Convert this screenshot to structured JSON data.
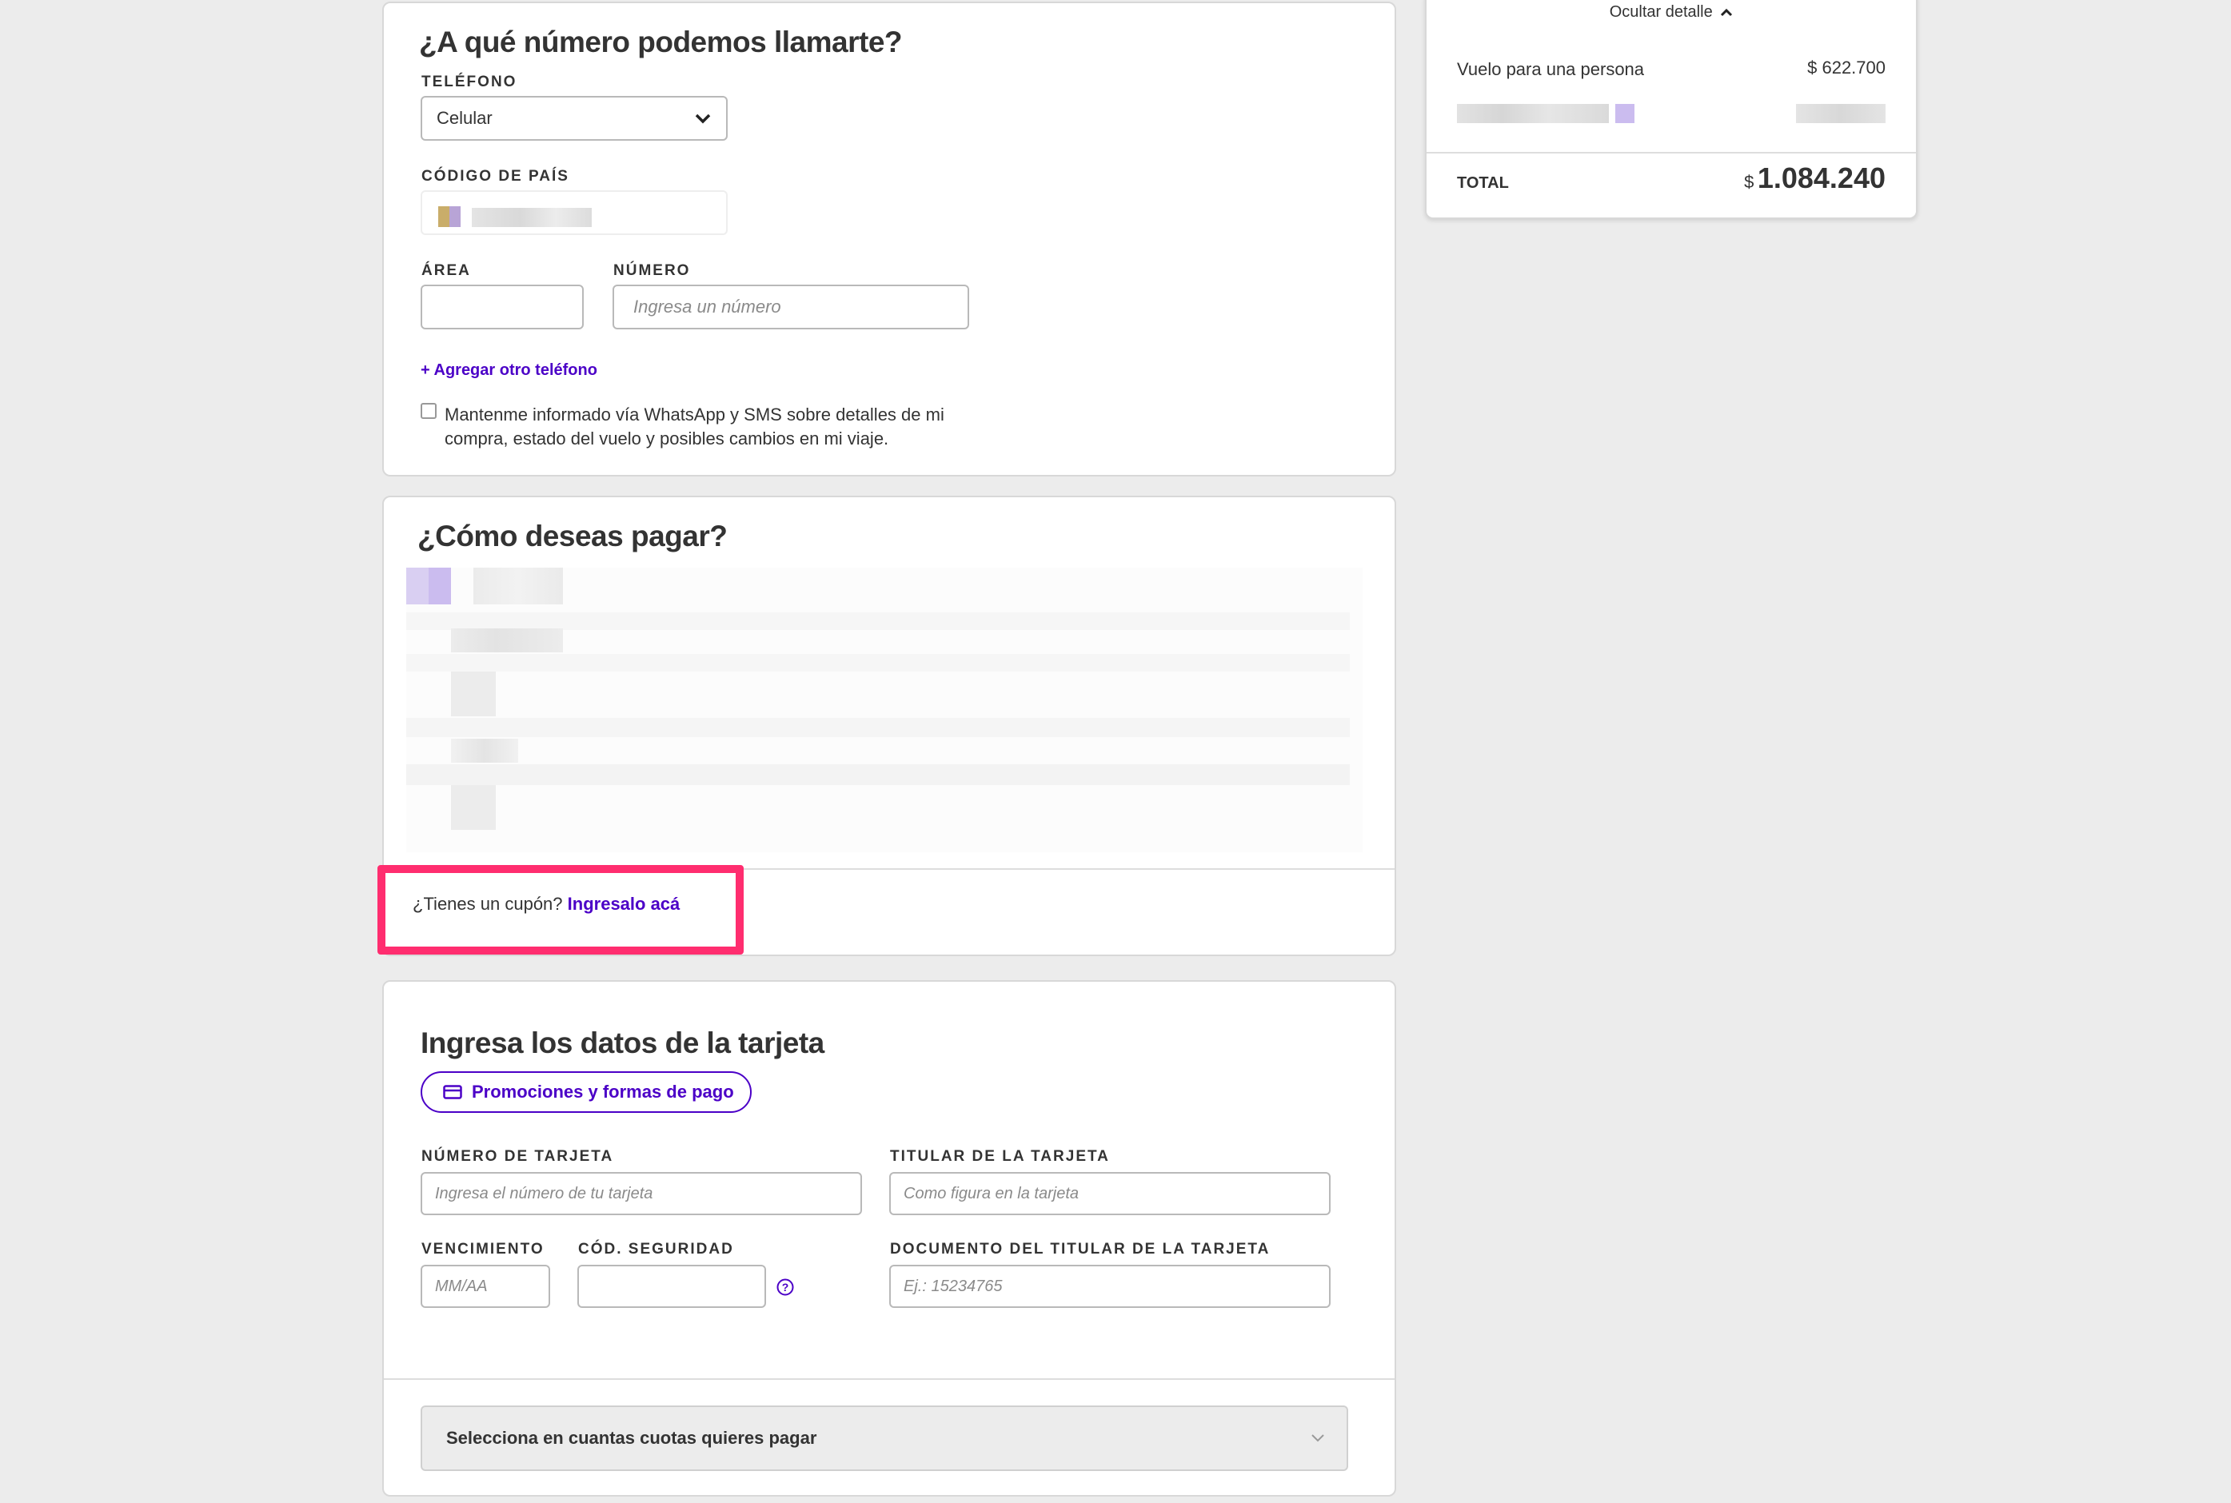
{
  "phone_section": {
    "title": "¿A qué número podemos llamarte?",
    "phone_label": "TELÉFONO",
    "phone_type_value": "Celular",
    "country_code_label": "CÓDIGO DE PAÍS",
    "area_label": "ÁREA",
    "area_value": "",
    "number_label": "NÚMERO",
    "number_placeholder": "Ingresa un número",
    "add_phone_link": "+ Agregar otro teléfono",
    "whatsapp_checkbox_line1": "Mantenme informado vía WhatsApp y SMS sobre detalles de mi",
    "whatsapp_checkbox_line2": "compra, estado del vuelo y posibles cambios en mi viaje.",
    "whatsapp_checked": false
  },
  "payment_section": {
    "title": "¿Cómo deseas pagar?",
    "coupon_text": "¿Tienes un cupón?",
    "coupon_link": "Ingresalo acá"
  },
  "card_section": {
    "title": "Ingresa los datos de la tarjeta",
    "promo_button": "Promociones y formas de pago",
    "card_number_label": "NÚMERO DE TARJETA",
    "card_number_placeholder": "Ingresa el número de tu tarjeta",
    "holder_label": "TITULAR DE LA TARJETA",
    "holder_placeholder": "Como figura en la tarjeta",
    "expiry_label": "VENCIMIENTO",
    "expiry_placeholder": "MM/AA",
    "cvv_label": "CÓD. SEGURIDAD",
    "document_label": "DOCUMENTO DEL TITULAR DE LA TARJETA",
    "document_placeholder": "Ej.: 15234765",
    "installments_select": "Selecciona en cuantas cuotas quieres pagar"
  },
  "summary": {
    "hide_detail": "Ocultar detalle",
    "flight_label": "Vuelo para una persona",
    "flight_price": "$ 622.700",
    "total_label": "TOTAL",
    "total_currency": "$",
    "total_amount": "1.084.240"
  },
  "colors": {
    "accent": "#4b00c7",
    "highlight": "#ff2d6f",
    "background": "#ececec"
  },
  "icons": [
    "chevron-down-icon",
    "chevron-up-icon",
    "help-circle-icon",
    "credit-card-icon"
  ]
}
